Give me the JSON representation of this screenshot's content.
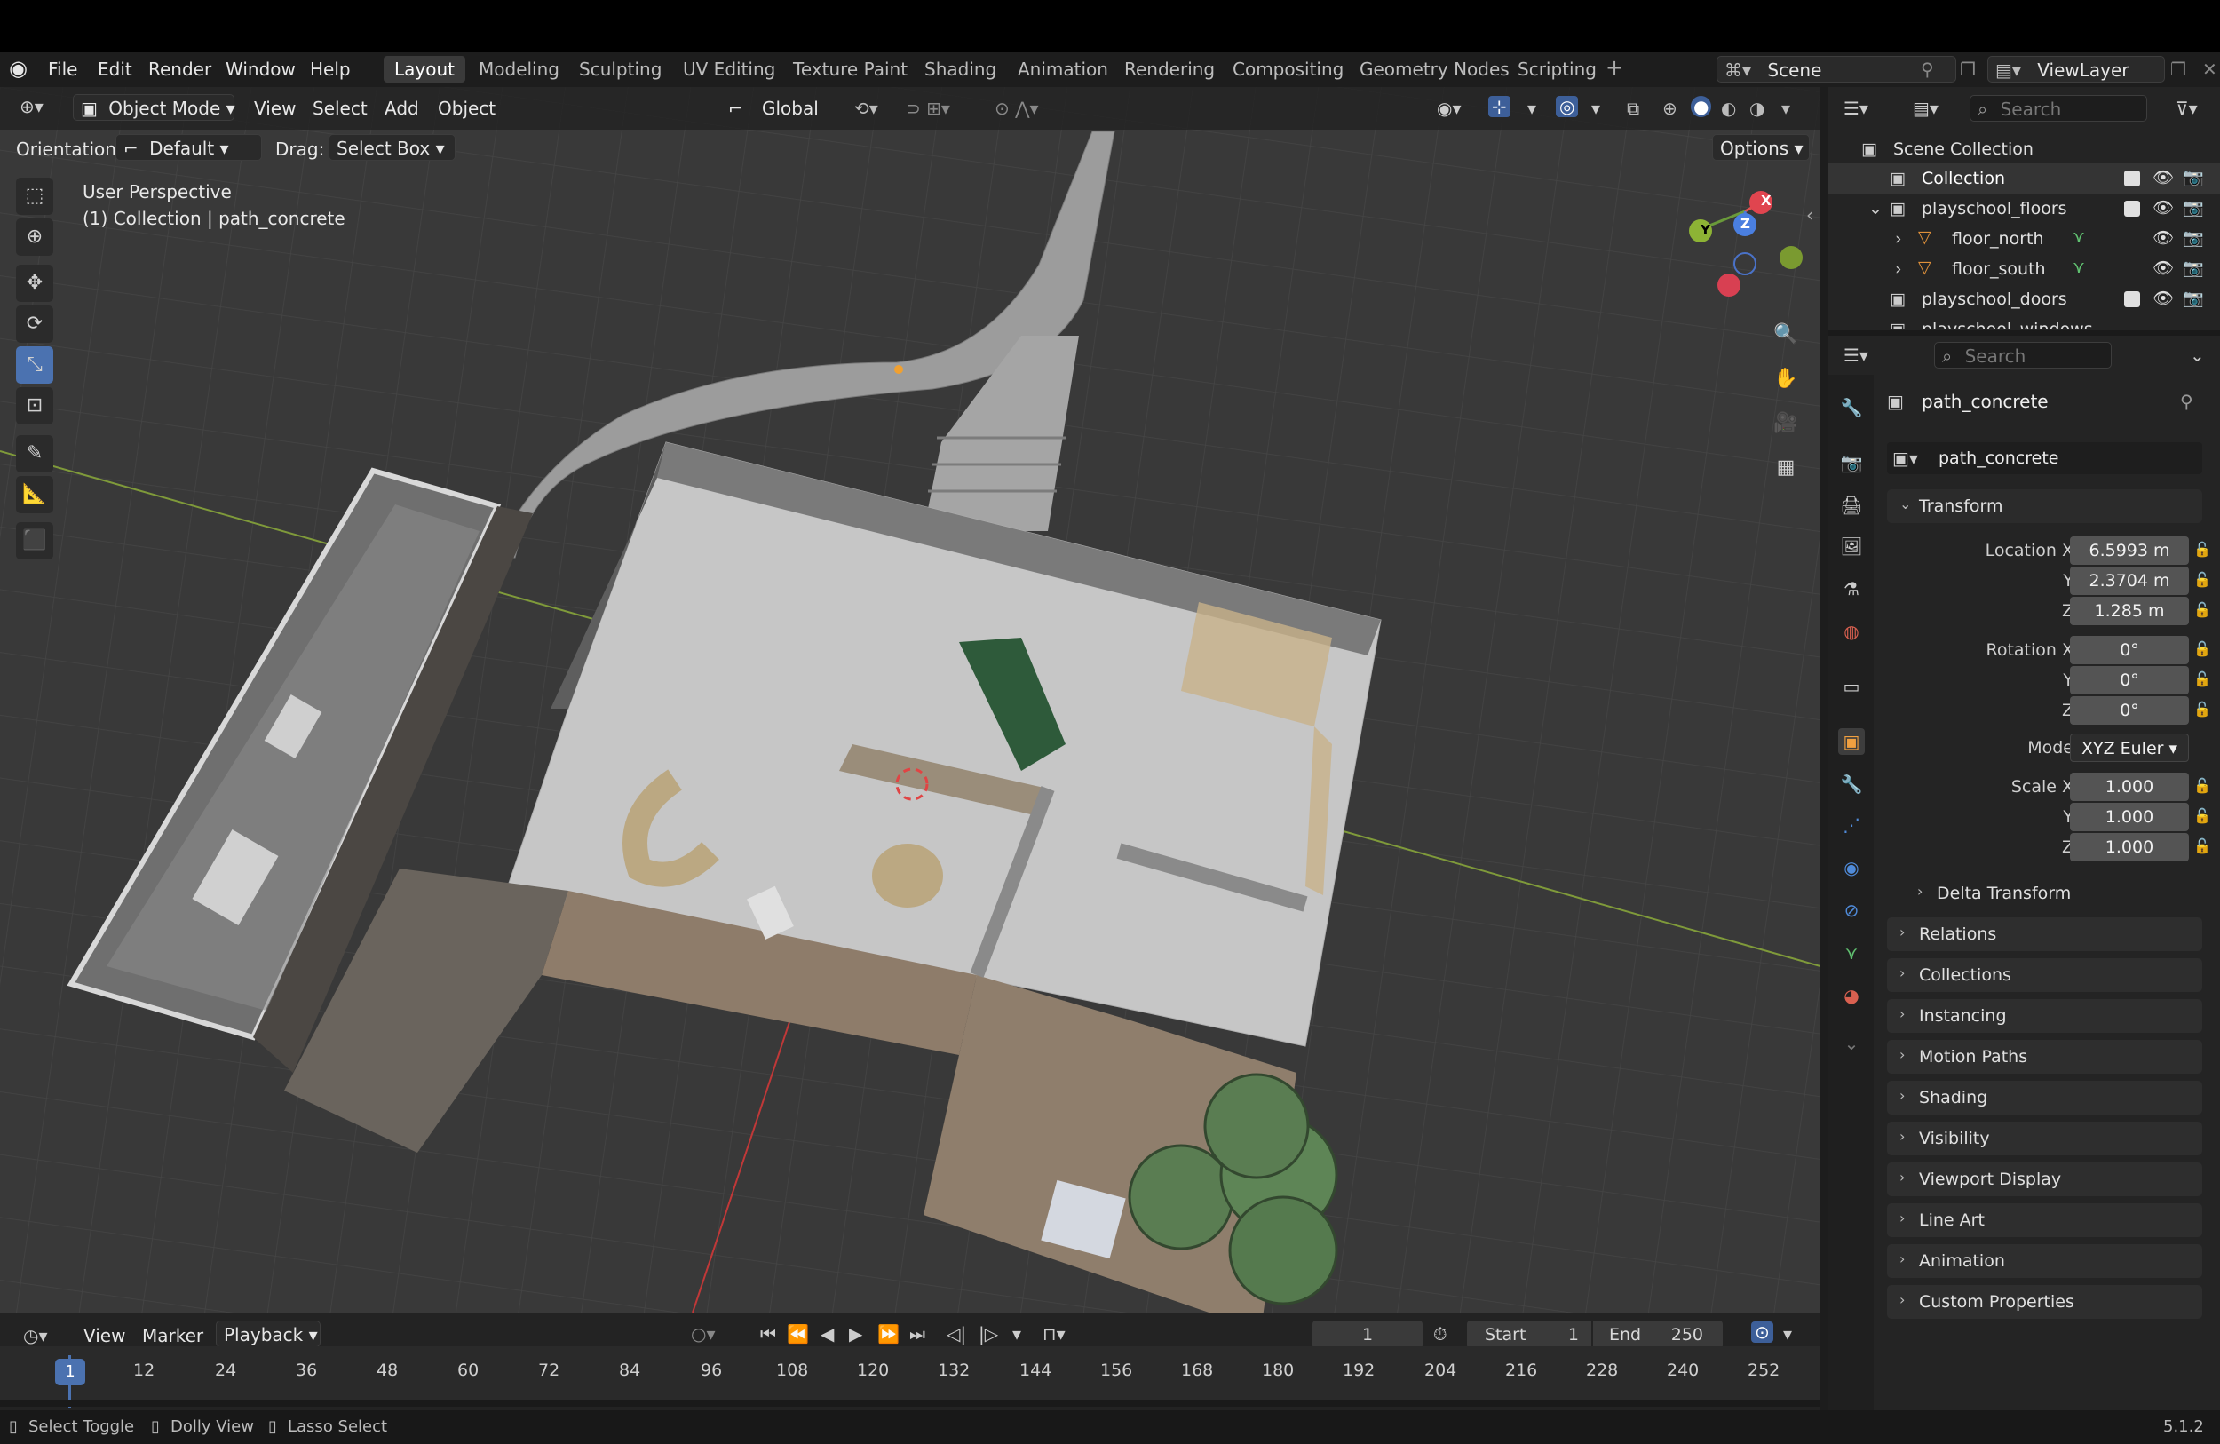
{
  "menu": {
    "file": "File",
    "edit": "Edit",
    "render": "Render",
    "window": "Window",
    "help": "Help"
  },
  "workspaces": [
    "Layout",
    "Modeling",
    "Sculpting",
    "UV Editing",
    "Texture Paint",
    "Shading",
    "Animation",
    "Rendering",
    "Compositing",
    "Geometry Nodes",
    "Scripting"
  ],
  "scene": {
    "name": "Scene",
    "view_layer": "ViewLayer"
  },
  "viewport": {
    "mode": "Object Mode",
    "view": "View",
    "select": "Select",
    "add": "Add",
    "object": "Object",
    "transform_orientation": "Global",
    "orientation_label": "Orientation:",
    "orientation_value": "Default",
    "drag_label": "Drag:",
    "drag_value": "Select Box",
    "options": "Options",
    "perspective": "User Perspective",
    "collection_info": "(1) Collection | path_concrete",
    "gizmo_x": "X",
    "gizmo_y": "Y",
    "gizmo_z": "Z"
  },
  "outliner": {
    "search_placeholder": "Search",
    "items": [
      {
        "label": "Scene Collection"
      },
      {
        "label": "Collection"
      },
      {
        "label": "playschool_floors"
      },
      {
        "label": "floor_north"
      },
      {
        "label": "floor_south"
      },
      {
        "label": "playschool_doors"
      },
      {
        "label": "playschool_windows"
      }
    ]
  },
  "properties": {
    "search_placeholder": "Search",
    "object_name": "path_concrete",
    "object_field": "path_concrete",
    "transform_title": "Transform",
    "location_label": "Location X",
    "loc_x": "6.5993 m",
    "loc_y": "2.3704 m",
    "loc_z": "1.285 m",
    "rotation_label": "Rotation X",
    "rot_x": "0°",
    "rot_y": "0°",
    "rot_z": "0°",
    "mode_label": "Mode",
    "mode_value": "XYZ Euler",
    "scale_label": "Scale X",
    "scale_x": "1.000",
    "scale_y": "1.000",
    "scale_z": "1.000",
    "y_label": "Y",
    "z_label": "Z",
    "delta": "Delta Transform",
    "sections": [
      "Relations",
      "Collections",
      "Instancing",
      "Motion Paths",
      "Shading",
      "Visibility",
      "Viewport Display",
      "Line Art",
      "Animation",
      "Custom Properties"
    ]
  },
  "timeline": {
    "view": "View",
    "marker": "Marker",
    "playback": "Playback",
    "current_frame": "1",
    "start_label": "Start",
    "start": "1",
    "end_label": "End",
    "end": "250",
    "ticks": [
      "12",
      "24",
      "36",
      "48",
      "60",
      "72",
      "84",
      "96",
      "108",
      "120",
      "132",
      "144",
      "156",
      "168",
      "180",
      "192",
      "204",
      "216",
      "228",
      "240",
      "252"
    ],
    "playhead": "1"
  },
  "status": {
    "select_toggle": "Select Toggle",
    "dolly_view": "Dolly View",
    "lasso_select": "Lasso Select",
    "version": "5.1.2"
  }
}
